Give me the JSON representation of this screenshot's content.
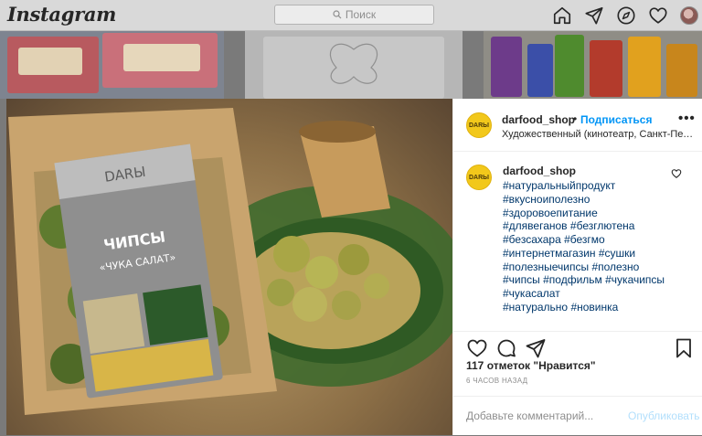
{
  "topbar": {
    "logo": "Instagram",
    "search_placeholder": "Поиск",
    "icons": [
      "home-icon",
      "direct-icon",
      "explore-icon",
      "activity-heart-icon",
      "profile-avatar"
    ]
  },
  "post": {
    "image_icon": "chips-product-photo",
    "header": {
      "username": "darfood_shop",
      "follow_label": "Подписаться",
      "location": "Художественный (кинотеатр, Санкт-Петербург)",
      "more_icon": "more-options-icon"
    },
    "caption": {
      "username": "darfood_shop",
      "hashtags": [
        "#натуральныйпродукт",
        "#вкусноиполезно",
        "#здоровоепитание",
        "#длявеганов",
        "#безглютена",
        "#безсахара",
        "#безгмо",
        "#интернетмагазин",
        "#сушки",
        "#полезныечипсы",
        "#полезно",
        "#чипсы",
        "#подфильм",
        "#чукачипсы",
        "#чукасалат",
        "#натурально",
        "#новинка"
      ]
    },
    "likes_text": "117 отметок \"Нравится\"",
    "time_ago": "6 ЧАСОВ НАЗАД",
    "comment": {
      "placeholder": "Добавьте комментарий...",
      "publish_label": "Опубликовать"
    },
    "avatar_label": "DARЫ"
  },
  "colors": {
    "link": "#00376b",
    "accent": "#0095f6",
    "publish_disabled": "#b2dffc",
    "brand_yellow": "#f2c81b"
  }
}
